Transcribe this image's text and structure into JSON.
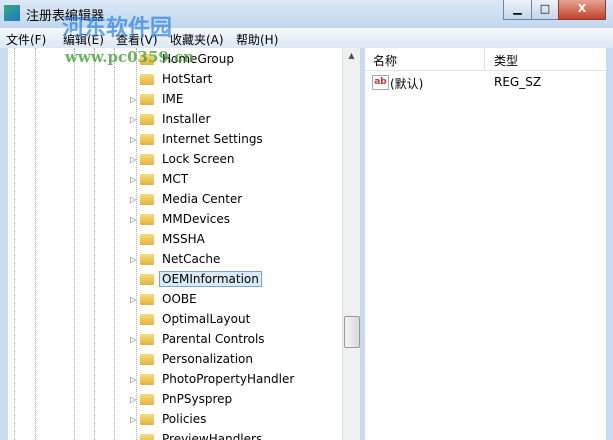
{
  "window": {
    "title": "注册表编辑器",
    "minimize": "▁",
    "maximize": "□",
    "close": "X"
  },
  "menu": [
    "文件(F)",
    "编辑(E)",
    "查看(V)",
    "收藏夹(A)",
    "帮助(H)"
  ],
  "watermark": {
    "brand": "河东软件园",
    "url": "www.pc0359.cn"
  },
  "tree": [
    {
      "label": "HomeGroup",
      "expandable": false
    },
    {
      "label": "HotStart",
      "expandable": false
    },
    {
      "label": "IME",
      "expandable": true
    },
    {
      "label": "Installer",
      "expandable": true
    },
    {
      "label": "Internet Settings",
      "expandable": true
    },
    {
      "label": "Lock Screen",
      "expandable": true
    },
    {
      "label": "MCT",
      "expandable": true
    },
    {
      "label": "Media Center",
      "expandable": true
    },
    {
      "label": "MMDevices",
      "expandable": true
    },
    {
      "label": "MSSHA",
      "expandable": false
    },
    {
      "label": "NetCache",
      "expandable": true
    },
    {
      "label": "OEMInformation",
      "expandable": false,
      "selected": true
    },
    {
      "label": "OOBE",
      "expandable": true
    },
    {
      "label": "OptimalLayout",
      "expandable": false
    },
    {
      "label": "Parental Controls",
      "expandable": true
    },
    {
      "label": "Personalization",
      "expandable": false
    },
    {
      "label": "PhotoPropertyHandler",
      "expandable": true
    },
    {
      "label": "PnPSysprep",
      "expandable": true
    },
    {
      "label": "Policies",
      "expandable": true
    },
    {
      "label": "PreviewHandlers",
      "expandable": false
    }
  ],
  "values": {
    "headers": [
      "名称",
      "类型"
    ],
    "rows": [
      {
        "icon": "ab",
        "name": "(默认)",
        "type": "REG_SZ"
      }
    ]
  }
}
